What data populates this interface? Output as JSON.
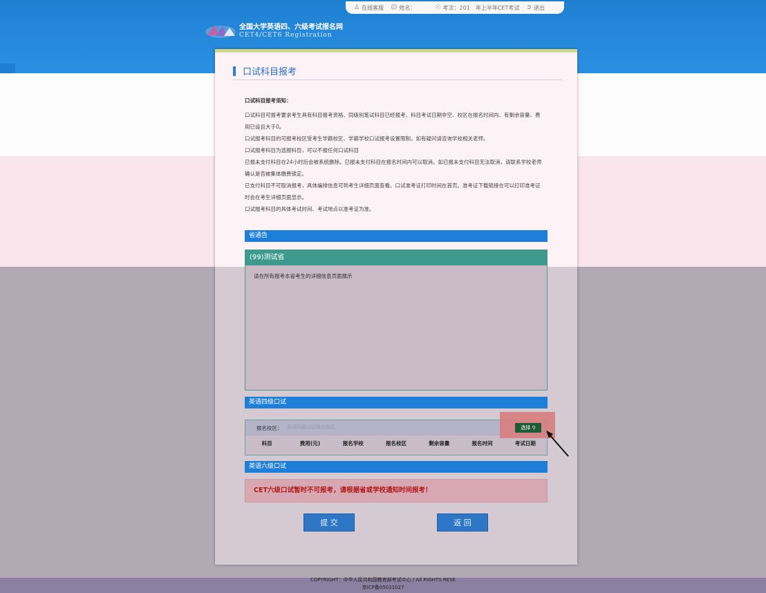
{
  "topbar": {
    "service": "在线客服",
    "name_label": "姓名：",
    "exam": "考次：201　年上半年CET考试",
    "logout": "退出"
  },
  "site": {
    "title_cn": "全国大学英语四、六级考试报名网",
    "title_en": "CET4/CET6  Registration"
  },
  "page": {
    "title": "口试科目报考"
  },
  "notice": {
    "heading": "口试科目报考须知：",
    "lines": [
      "口试科目可报考要求考生具有科目报考资格、同级别笔试科目已经报考、科目考试日期非空、校区在报名时间内、有剩余容量、费",
      "用已设且大于0。",
      "口试报考科目的可报考校区受考生学籍校区、学籍学校口试报考设置限制，如有疑问请咨询学校相关老师。",
      "口试报考科目为选报科目，可以不报任何口试科目",
      "已报未支付科目在24小时后会被系统删除。已报未支付科目在报名时间内可以取消。如已报未支付科目无法取消，请联系学校老师",
      "确认是否被集体缴费锁定。",
      "已支付科目不可取消报考，具体编排信息可到考生详细页面查看。口试准考证打印时间在首页。准考证下载链接在可以打印准考证",
      "时会在考生详细页面显示。",
      "口试报考科目的具体考试时间、考试地点以准考证为准。"
    ]
  },
  "province_notice": {
    "bar": "省通告",
    "name": "(99)测试省",
    "body": "请在所有报考本省考生的详细信息页面展示"
  },
  "cet4_oral": {
    "bar": "英语四级口试",
    "campus_label": "报名校区：",
    "campus_placeholder": "英语四级口试报名校区...",
    "select_button": "选择",
    "columns": [
      "科目",
      "费用(元)",
      "报名学校",
      "报名校区",
      "剩余容量",
      "报名时间",
      "考试日期"
    ]
  },
  "cet6_oral": {
    "bar": "英语六级口试",
    "warning": "CET六级口试暂时不可报考，请根据省或学校通知时间报考！"
  },
  "actions": {
    "submit": "提 交",
    "back": "返 回"
  },
  "footer": {
    "copyright": "COPYRIGHT：中华人民共和国教育部考试中心 / All RIGHTS RESE",
    "icp": "京ICP备05031027"
  },
  "colors": {
    "accent_blue": "#1e7fd8",
    "teal_header": "#3f9a8e",
    "warning_text": "#b01818",
    "select_button": "#1e5a34"
  }
}
